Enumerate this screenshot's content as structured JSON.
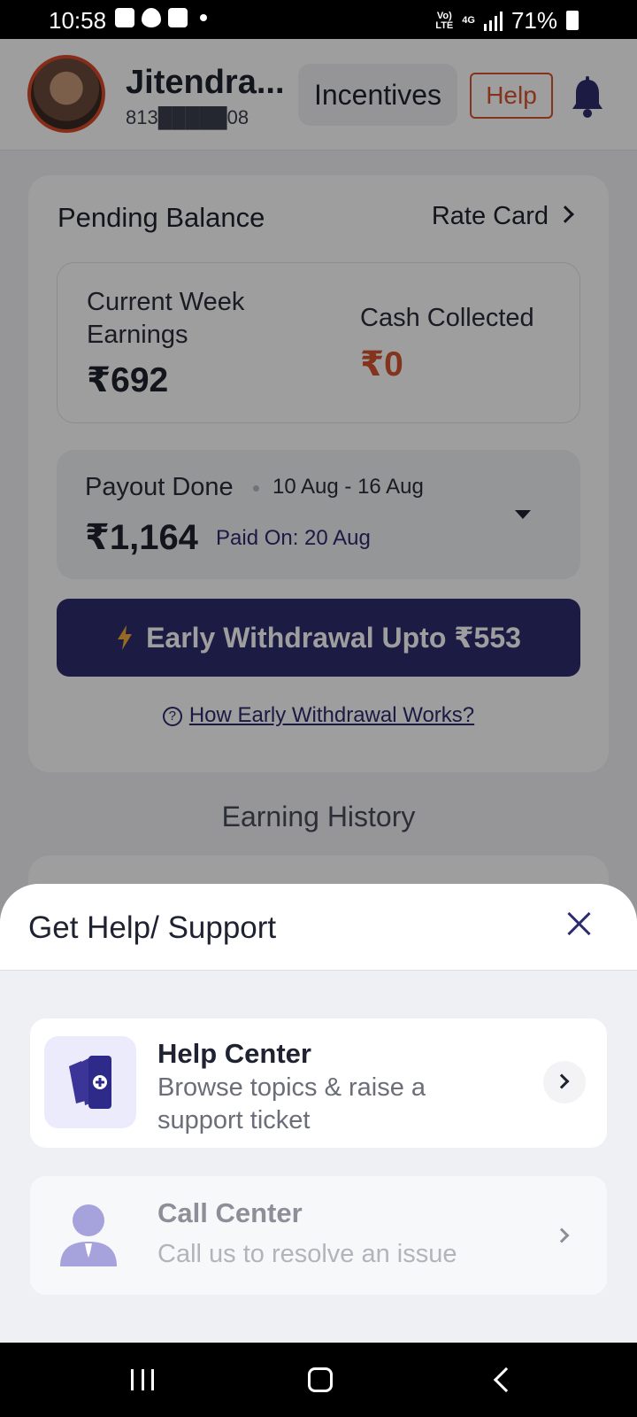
{
  "status_bar": {
    "time": "10:58",
    "network_top": "Vo)",
    "network_bottom": "LTE",
    "data_type": "4G",
    "battery": "71%"
  },
  "header": {
    "driver_name": "Jitendra...",
    "phone": "813█████08",
    "incentives_label": "Incentives",
    "help_label": "Help"
  },
  "balance": {
    "title": "Pending Balance",
    "rate_card_label": "Rate Card",
    "current_week_label": "Current Week Earnings",
    "current_week_value": "₹692",
    "cash_collected_label": "Cash Collected",
    "cash_collected_value": "₹0"
  },
  "payout": {
    "label": "Payout Done",
    "date_range": "10 Aug - 16 Aug",
    "amount": "₹1,164",
    "paid_on": "Paid On: 20 Aug"
  },
  "early_withdrawal": {
    "button_label": "Early Withdrawal Upto ₹553",
    "help_link": "How Early Withdrawal Works?"
  },
  "earning_history_title": "Earning History",
  "sheet": {
    "title": "Get Help/ Support",
    "options": [
      {
        "title": "Help Center",
        "description": "Browse topics & raise a support ticket"
      },
      {
        "title": "Call Center",
        "description": "Call us to resolve an issue"
      }
    ]
  },
  "colors": {
    "brand_navy": "#2c2c6e",
    "accent_orange": "#d6532f",
    "icon_lavender": "#ecebfb"
  }
}
